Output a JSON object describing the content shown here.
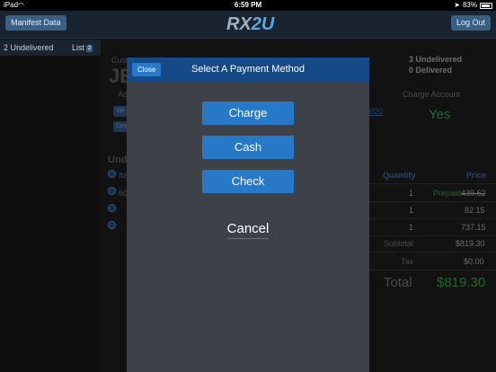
{
  "statusbar": {
    "device": "iPad",
    "time": "6:59 PM",
    "battery": "83%",
    "wifi_icon": "wifi-icon",
    "location_icon": "location-arrow-icon"
  },
  "nav": {
    "manifest_label": "Manifest Data",
    "logout_label": "Log Out",
    "logo_rx": "RX",
    "logo_num": "2U"
  },
  "sidebar": {
    "count_label": "2 Undelivered",
    "list_label": "List",
    "list_badge": "2"
  },
  "background": {
    "customer_label": "Cust",
    "customer_name": "JE",
    "address_label": "Ad",
    "view_label": "Vie",
    "dev_label": "Dev",
    "undelivered_header": "Und",
    "undelivered_count": "3 Undelivered",
    "delivered_count": "0 Delivered",
    "charge_account_label": "Charge Account",
    "charge_account_value": "Yes",
    "link_fragment": "020",
    "col_quantity": "Quantity",
    "col_price": "Price",
    "item1_name": "Ite",
    "item2_name": "60",
    "rows": [
      {
        "qty": "1",
        "prepaid": "Prepaid",
        "price": "439.62"
      },
      {
        "qty": "1",
        "price": "82.15"
      },
      {
        "qty": "1",
        "price": "737.15"
      }
    ],
    "subtotal_label": "Subtotal",
    "subtotal_value": "$819.30",
    "tax_label": "Tax",
    "tax_value": "$0.00",
    "total_label": "Total",
    "total_value": "$819.30"
  },
  "modal": {
    "title": "Select A Payment Method",
    "close_label": "Close",
    "charge_label": "Charge",
    "cash_label": "Cash",
    "check_label": "Check",
    "cancel_label": "Cancel"
  }
}
